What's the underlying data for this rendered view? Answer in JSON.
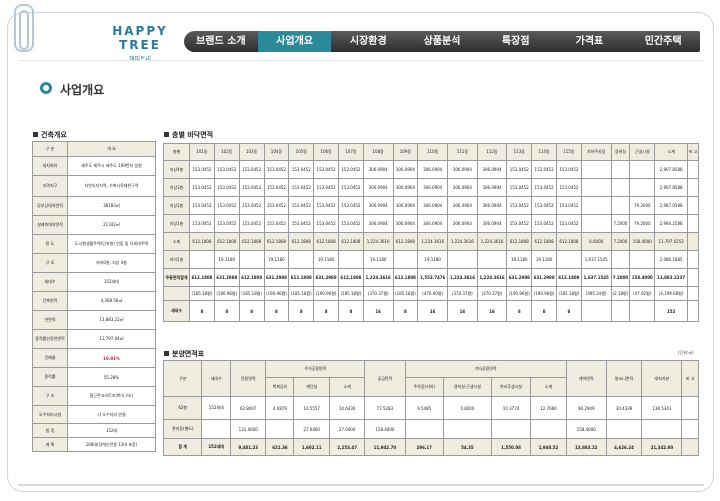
{
  "nav": {
    "items": [
      "브랜드 소개",
      "사업개요",
      "시장환경",
      "상품분석",
      "특장점",
      "가격표",
      "민간주택"
    ],
    "active_index": 1
  },
  "logo": {
    "brand": "HAPPY TREE",
    "sub": "해피트리"
  },
  "page_title": "사업개요",
  "overview": {
    "title": "건축개요",
    "header": [
      "구 분",
      "개 요"
    ],
    "rows": [
      [
        "대지위치",
        "제주도 제주시 제주도 109번지 일원"
      ],
      [
        "지역지구",
        "자연녹지지역, 가축사육제한구역"
      ],
      [
        "공부상대지면적",
        "38183㎡"
      ],
      [
        "실제측대지면적",
        "21342㎡"
      ],
      [
        "용 도",
        "도시형생활주택(단지형) 연립 및 다세대주택"
      ],
      [
        "규 모",
        "지하0층, 지상 4층"
      ],
      [
        "세대수",
        "152세대"
      ],
      [
        "건축면적",
        "4,368.56㎡"
      ],
      [
        "연면적",
        "13,883.22㎡"
      ],
      [
        "용적률산정연면적",
        "11,797.04㎡"
      ],
      [
        "건폐율",
        "19.93%"
      ],
      [
        "용적률",
        "55.28%"
      ],
      [
        "구 조",
        "철근콘크리트조(벽식구조)"
      ],
      [
        "오수처리시설",
        "사 오수처리 연결"
      ],
      [
        "법 정",
        "152대"
      ],
      [
        "계 획",
        "168대(장애인전용 13대 포함)"
      ]
    ],
    "hl_row": 10
  },
  "floor_table": {
    "title": "층별 바닥면적",
    "headers": [
      "층별",
      "101동",
      "102동",
      "103동",
      "104동",
      "105동",
      "106동",
      "107동",
      "108동",
      "109동",
      "110동",
      "111동",
      "112동",
      "113동",
      "114동",
      "115동",
      "지하주차장",
      "경비실",
      "근생시설",
      "소계",
      "비 고"
    ],
    "rows": [
      [
        "지상4층",
        "153.0452",
        "153.0452",
        "153.0452",
        "153.0452",
        "153.0452",
        "153.0452",
        "153.0452",
        "306.0904",
        "306.0904",
        "306.0904",
        "306.0904",
        "306.0904",
        "153.0452",
        "153.0452",
        "153.0452",
        "",
        "",
        "",
        "2,907.8588",
        ""
      ],
      [
        "지상3층",
        "153.0452",
        "153.0452",
        "153.0452",
        "153.0452",
        "153.0452",
        "153.0452",
        "153.0452",
        "306.0904",
        "306.0904",
        "306.0904",
        "306.0904",
        "306.0904",
        "153.0452",
        "153.0452",
        "153.0452",
        "",
        "",
        "",
        "2,907.8588",
        ""
      ],
      [
        "지상2층",
        "153.0452",
        "153.0452",
        "153.0452",
        "153.0452",
        "153.0452",
        "153.0452",
        "153.0452",
        "306.0904",
        "306.0904",
        "306.0904",
        "306.0904",
        "306.0904",
        "153.0452",
        "153.0452",
        "153.0452",
        "",
        "",
        "79.2000",
        "2,987.0588",
        ""
      ],
      [
        "지상1층",
        "153.0452",
        "153.0452",
        "153.0452",
        "153.0452",
        "153.0452",
        "153.0452",
        "153.0452",
        "306.0904",
        "306.0904",
        "306.0904",
        "306.0904",
        "306.0904",
        "153.0452",
        "153.0452",
        "153.0452",
        "",
        "7.2000",
        "79.2000",
        "2,994.2588",
        ""
      ],
      [
        "소계",
        "612.1808",
        "612.1808",
        "612.1808",
        "612.1808",
        "612.1808",
        "612.1808",
        "612.1808",
        "1,224.3616",
        "612.1808",
        "1,224.3616",
        "1,224.3616",
        "1,224.3616",
        "612.1808",
        "612.1808",
        "612.1808",
        "0.0000",
        "7.2000",
        "158.4000",
        "11,797.0352",
        ""
      ],
      [
        "지하1층",
        "",
        "19.1180",
        "",
        "19.1180",
        "",
        "19.1180",
        "",
        "19.1180",
        "",
        "19.1180",
        "",
        "",
        "19.1180",
        "19.1180",
        "",
        "1,637.1545",
        "",
        "",
        "2,086.1885",
        ""
      ],
      [
        "주용면적합계",
        "612.1808",
        "631.2988",
        "612.1808",
        "631.2988",
        "612.1808",
        "631.2988",
        "612.1808",
        "1,224.3616",
        "612.1808",
        "1,553.7476",
        "1,224.3616",
        "1,224.3616",
        "631.2988",
        "631.2988",
        "612.1808",
        "1,637.1545",
        "7.2000",
        "158.4000",
        "13,883.2237",
        ""
      ],
      [
        "",
        "(185.18평)",
        "(190.96평)",
        "(185.18평)",
        "(190.96평)",
        "(185.18평)",
        "(190.96평)",
        "(185.18평)",
        "(370.37평)",
        "(185.18평)",
        "(470.00평)",
        "(370.37평)",
        "(370.37평)",
        "(190.96평)",
        "(190.96평)",
        "(185.18평)",
        "(495.24평)",
        "(2.18평)",
        "(47.92평)",
        "(4,199.68평)",
        ""
      ],
      [
        "세대수",
        "8",
        "8",
        "8",
        "8",
        "8",
        "8",
        "8",
        "16",
        "8",
        "16",
        "16",
        "16",
        "8",
        "8",
        "8",
        "",
        "",
        "",
        "152",
        ""
      ]
    ]
  },
  "sale_table": {
    "title": "분양면적표",
    "unit": "(단위:㎡)",
    "header_groups": [
      "구분",
      "세대수",
      "전용면적",
      "주거공용면적",
      "공급면적",
      "기타공용면적",
      "계약면적",
      "발코니면적",
      "대지지분",
      "비 고"
    ],
    "sub_headers": [
      "벽체공유",
      "계단실",
      "소계",
      "주차장(지하)",
      "경비실·근생시설",
      "복리후생시설",
      "소계"
    ],
    "rows": [
      [
        "62형",
        "152세대",
        "62.8007",
        "4.0879",
        "10.5557",
        "14.6436",
        "77.5283",
        "9.5485",
        "0.8200",
        "10.3774",
        "12.7666",
        "90.2949",
        "30.4339",
        "138.5343",
        ""
      ],
      [
        "관리동(별도)",
        "",
        "131.0600",
        "",
        "27.0400",
        "27.0400",
        "158.4000",
        "",
        "",
        "",
        "",
        "158.4000",
        "",
        "",
        ""
      ],
      [
        "합 계",
        "152세대",
        "9,481.23",
        "621.36",
        "1,602.11",
        "2,253.47",
        "11,942.70",
        "296.17",
        "54.35",
        "1,550.08",
        "1,940.52",
        "13,883.22",
        "4,626.24",
        "21,342.00",
        ""
      ]
    ]
  }
}
